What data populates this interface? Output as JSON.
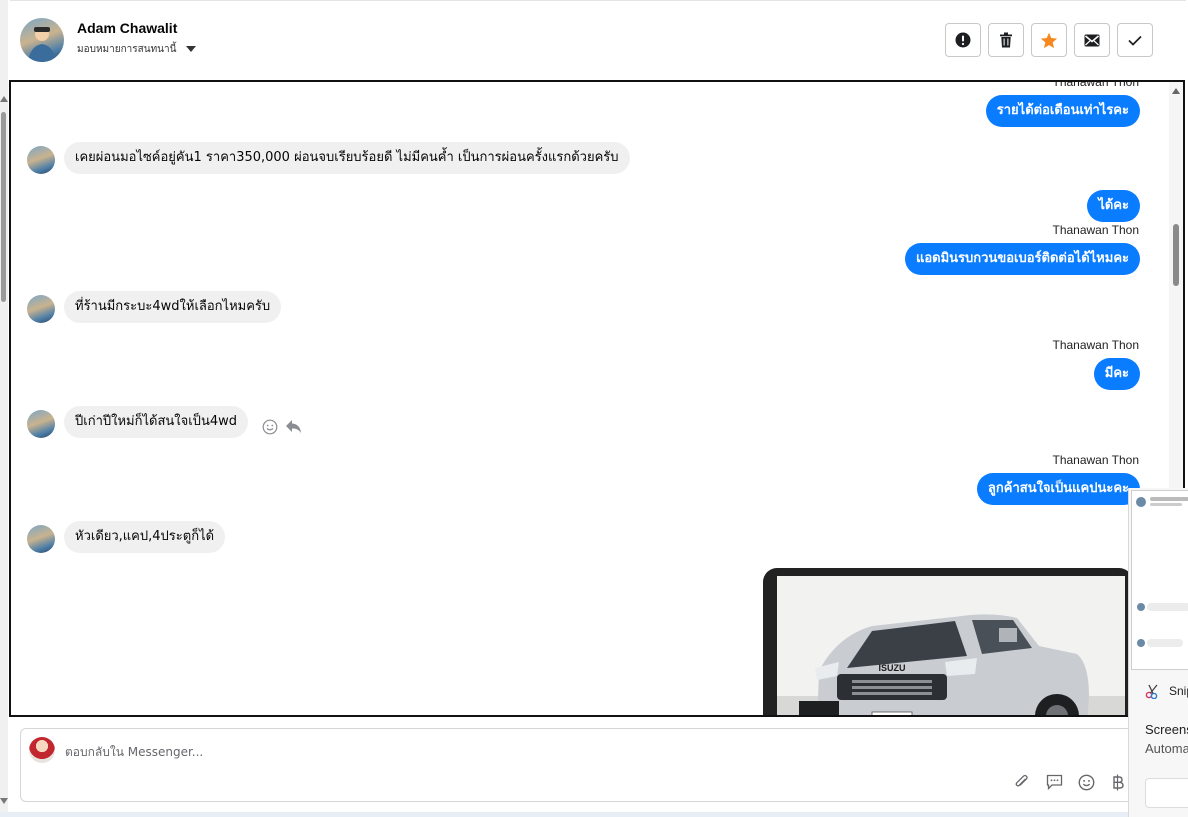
{
  "header": {
    "contact_name": "Adam Chawalit",
    "assign_label": "มอบหมายการสนทนานี้",
    "toolbar": [
      "spam-report",
      "delete",
      "star",
      "mark-unread",
      "done"
    ]
  },
  "colors": {
    "outgoing_bubble": "#0a7cff",
    "incoming_bubble": "#f0f0f0",
    "star": "#f5891f"
  },
  "messages": {
    "m0_sender": "Thanawan Thon",
    "m0_text": "รายได้ต่อเดือนเท่าไรคะ",
    "m1_text": "เคยผ่อนมอไซค์อยู่คัน1 ราคา350,000 ผ่อนจบเรียบร้อยดี ไม่มีคนค้ำ เป็นการผ่อนครั้งแรกด้วยครับ",
    "m2_text": "ได้คะ",
    "m3_sender": "Thanawan Thon",
    "m3_text": "แอดมินรบกวนขอเบอร์ติดต่อได้ไหมคะ",
    "m4_text": "ที่ร้านมีกระบะ4wdให้เลือกไหมครับ",
    "m5_sender": "Thanawan Thon",
    "m5_text": "มีคะ",
    "m6_text": "ปีเก่าปีใหม่ก็ได้สนใจเป็น4wd",
    "m7_sender": "Thanawan Thon",
    "m7_text": "ลูกค้าสนใจเป็นแคปนะคะ",
    "m8_text": "หัวเดียว,แคป,4ประตูก็ได้"
  },
  "photo": {
    "brand_text": "ISUZU"
  },
  "composer": {
    "placeholder": "ตอบกลับใน Messenger..."
  },
  "snip_notification": {
    "app_name": "Snip",
    "line1": "Screens",
    "line2": "Automa"
  }
}
